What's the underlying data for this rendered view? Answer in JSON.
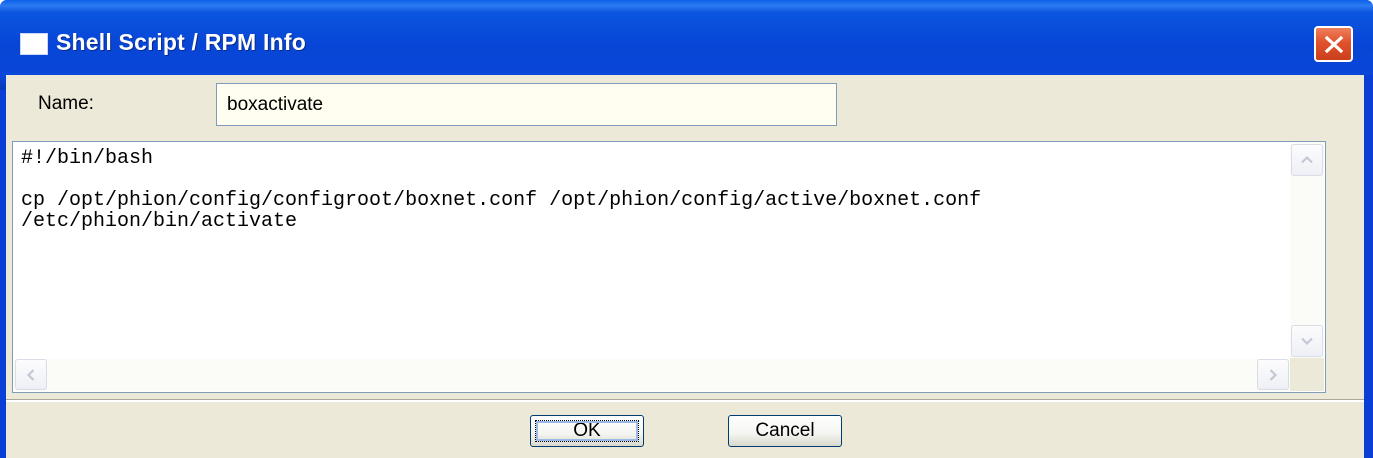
{
  "window": {
    "title": "Shell Script / RPM Info",
    "icon": "window-icon",
    "close_icon": "close-icon"
  },
  "form": {
    "name_label": "Name:",
    "name_value": "boxactivate"
  },
  "script": {
    "content": "#!/bin/bash\n\ncp /opt/phion/config/configroot/boxnet.conf /opt/phion/config/active/boxnet.conf\n/etc/phion/bin/activate"
  },
  "buttons": {
    "ok_label": "OK",
    "cancel_label": "Cancel"
  },
  "colors": {
    "titlebar": "#0745d6",
    "dialog_bg": "#ece9d8",
    "close_button": "#e0522c",
    "input_bg": "#fffef0"
  }
}
